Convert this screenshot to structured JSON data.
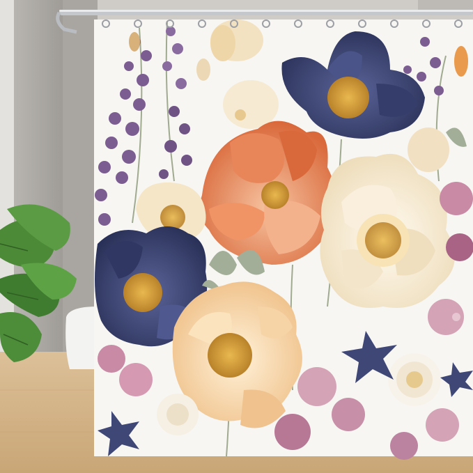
{
  "scene": {
    "subject": "floral-shower-curtain",
    "colors": {
      "wall": "#c9c6c1",
      "wall_light": "#dedbd6",
      "floor": "#d8b98c",
      "curtain_bg": "#f7f6f3",
      "navy": "#3e4775",
      "navy_dark": "#2a3158",
      "orange": "#e0794a",
      "orange_light": "#f2a47a",
      "cream": "#f4e8d0",
      "peach": "#f6d3a4",
      "pink": "#c98aa5",
      "lavender": "#7b5d91",
      "leaf": "#4f8f3c",
      "stem": "#9aa58c",
      "rod": "#b9bcc0",
      "stamen": "#d9a441"
    },
    "flowers": [
      {
        "name": "navy-poppy-top-right",
        "color": "navy"
      },
      {
        "name": "orange-poppy-center",
        "color": "orange"
      },
      {
        "name": "cream-peony-right",
        "color": "cream"
      },
      {
        "name": "navy-poppy-left",
        "color": "navy"
      },
      {
        "name": "peach-poppy-bottom",
        "color": "peach"
      },
      {
        "name": "pink-blossoms",
        "color": "pink"
      },
      {
        "name": "lavender-sprigs",
        "color": "lavender"
      }
    ],
    "hook_count": 12
  }
}
